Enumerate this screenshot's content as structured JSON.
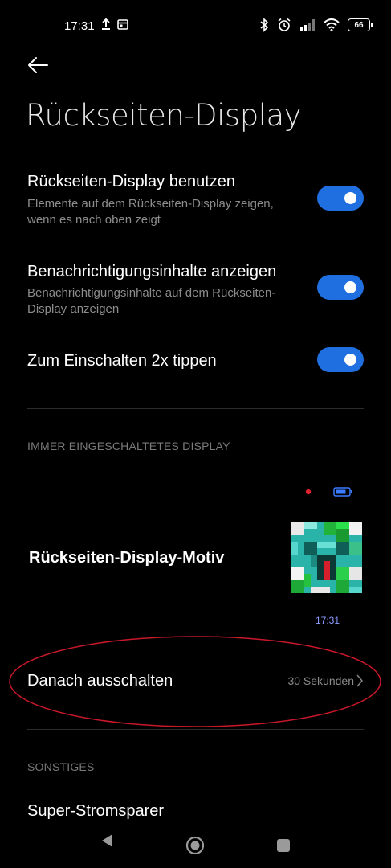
{
  "status_bar": {
    "time": "17:31",
    "battery": "66"
  },
  "header": {
    "title": "Rückseiten-Display"
  },
  "settings": {
    "use_display": {
      "title": "Rückseiten-Display benutzen",
      "subtitle": "Elemente auf dem Rückseiten-Display zeigen, wenn es nach oben zeigt",
      "enabled": true
    },
    "notifications": {
      "title": "Benachrichtigungsinhalte anzeigen",
      "subtitle": "Benachrichtigungsinhalte auf dem Rückseiten-Display anzeigen",
      "enabled": true
    },
    "double_tap": {
      "title": "Zum Einschalten 2x tippen",
      "enabled": true
    }
  },
  "always_on": {
    "section_header": "IMMER EINGESCHALTETES DISPLAY",
    "motif_label": "Rückseiten-Display-Motiv",
    "preview_time": "17:31",
    "turn_off_label": "Danach ausschalten",
    "turn_off_value": "30 Sekunden"
  },
  "other": {
    "section_header": "SONSTIGES",
    "super_saver_label": "Super-Stromsparer"
  },
  "colors": {
    "accent": "#1f6fe0",
    "annotation": "#c8182a"
  }
}
